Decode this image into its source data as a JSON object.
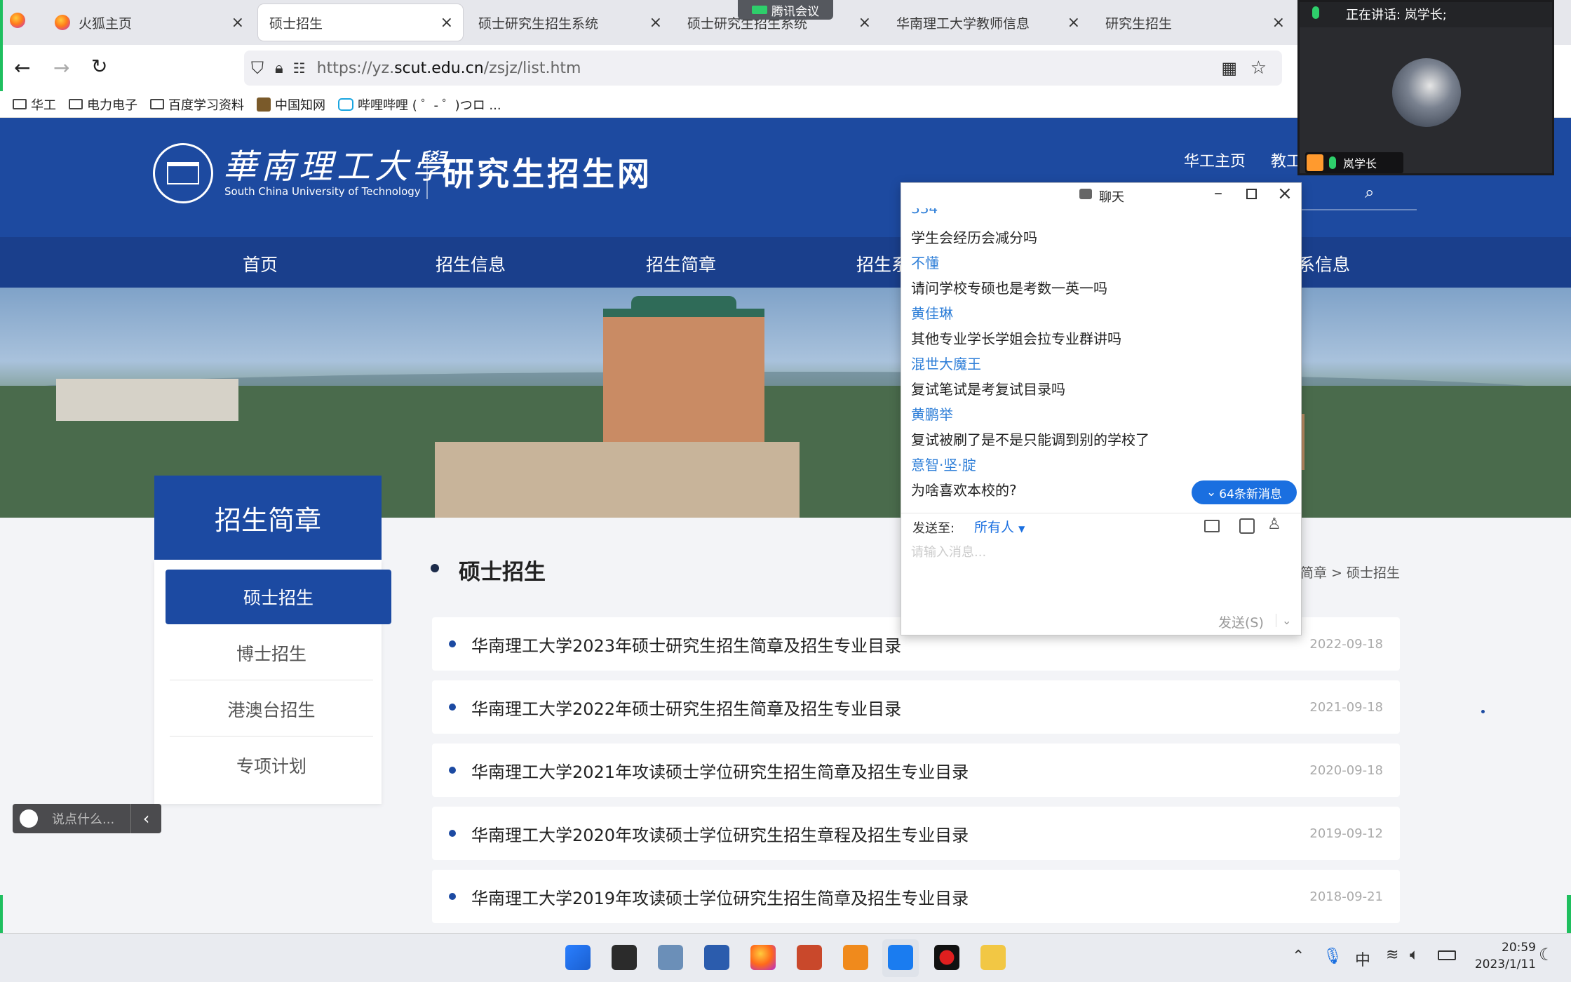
{
  "browser": {
    "tabs": [
      {
        "label": "火狐主页"
      },
      {
        "label": "硕士招生"
      },
      {
        "label": "硕士研究生招生系统"
      },
      {
        "label": "硕士研究生招生系统"
      },
      {
        "label": "华南理工大学教师信息"
      },
      {
        "label": "研究生招生"
      }
    ],
    "close_glyph": "×",
    "url_prefix": "https://yz.",
    "url_domain": "scut.edu.cn",
    "url_path": "/zsjz/list.htm",
    "bookmarks": [
      {
        "label": "华工",
        "icon": "folder-icon"
      },
      {
        "label": "电力电子",
        "icon": "folder-icon"
      },
      {
        "label": "百度学习资料",
        "icon": "folder-icon"
      },
      {
        "label": "中国知网",
        "icon": "cnki-icon"
      },
      {
        "label": "哔哩哔哩 ( ゜- ゜)つロ ...",
        "icon": "bilibili-icon"
      }
    ]
  },
  "tencent_meeting_bar": "腾讯会议",
  "site": {
    "logo_cn": "華南理工大學",
    "logo_en": "South China University of Technology",
    "site_title": "研究生招生网",
    "header_links": [
      "华工主页",
      "教工"
    ],
    "nav": [
      "首页",
      "招生信息",
      "招生简章",
      "招生系",
      "系信息"
    ],
    "sidebar_title": "招生简章",
    "sidebar_items": [
      "硕士招生",
      "博士招生",
      "港澳台招生",
      "专项计划"
    ],
    "section_title": "硕士招生",
    "breadcrumb": "招生简章 > 硕士招生",
    "list": [
      {
        "title": "华南理工大学2023年硕士研究生招生简章及招生专业目录",
        "date": "2022-09-18"
      },
      {
        "title": "华南理工大学2022年硕士研究生招生简章及招生专业目录",
        "date": "2021-09-18"
      },
      {
        "title": "华南理工大学2021年攻读硕士学位研究生招生简章及招生专业目录",
        "date": "2020-09-18"
      },
      {
        "title": "华南理工大学2020年攻读硕士学位研究生招生章程及招生专业目录",
        "date": "2019-09-12"
      },
      {
        "title": "华南理工大学2019年攻读硕士学位研究生招生简章及招生专业目录",
        "date": "2018-09-21"
      }
    ]
  },
  "chat": {
    "title": "聊天",
    "messages": [
      {
        "text": "学生会经历会减分吗",
        "type": "msg"
      },
      {
        "text": "不懂",
        "type": "name"
      },
      {
        "text": "请问学校专硕也是考数一英一吗",
        "type": "msg"
      },
      {
        "text": "黄佳琳",
        "type": "name"
      },
      {
        "text": "其他专业学长学姐会拉专业群讲吗",
        "type": "msg"
      },
      {
        "text": "混世大魔王",
        "type": "name"
      },
      {
        "text": "复试笔试是考复试目录吗",
        "type": "msg"
      },
      {
        "text": "黄鹏举",
        "type": "name"
      },
      {
        "text": "复试被刷了是不是只能调到别的学校了",
        "type": "msg"
      },
      {
        "text": "意智·坚·腚",
        "type": "name"
      },
      {
        "text": "为啥喜欢本校的?",
        "type": "msg"
      }
    ],
    "new_messages_badge": "64条新消息",
    "send_to_label": "发送至:",
    "send_to_value": "所有人",
    "input_placeholder": "请输入消息...",
    "send_button": "发送(S)"
  },
  "meeting": {
    "speaking_label": "正在讲话: 岚学长;",
    "participant_name": "岚学长"
  },
  "danmaku": {
    "placeholder": "说点什么..."
  },
  "taskbar": {
    "time": "20:59",
    "date": "2023/1/11",
    "ime": "中"
  }
}
